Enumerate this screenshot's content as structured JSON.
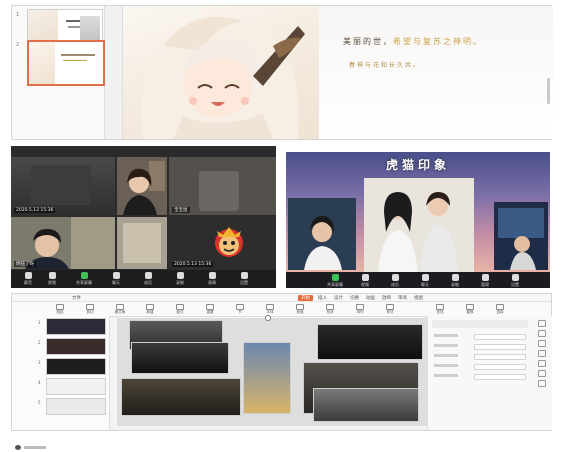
{
  "slide_editor": {
    "slides": [
      {
        "number": "1",
        "selected": false
      },
      {
        "number": "2",
        "selected": true
      }
    ],
    "quote_part1": "美丽的世，",
    "quote_part2": "希望与复苏之神明。",
    "subtitle": "春神与花和长久共。"
  },
  "meeting": {
    "participants": [
      {
        "name": "2020.5.13 15:36"
      },
      {
        "name": ""
      },
      {
        "name": "宝宝鼠"
      },
      {
        "name": "明钰了呀"
      },
      {
        "name": "2020.5.13 15:36"
      }
    ],
    "toolbar": [
      "静音",
      "视频",
      "共享屏幕",
      "聊天",
      "成员",
      "录制",
      "表情",
      "设置"
    ]
  },
  "poster_slide": {
    "title": "虎猫印象",
    "toolbar": [
      "共享屏幕",
      "视频",
      "成员",
      "聊天",
      "录制",
      "管理",
      "设置"
    ]
  },
  "editor": {
    "active_tab": "开始",
    "tabs": [
      "文件",
      "开始",
      "插入",
      "设计",
      "切换",
      "动画",
      "放映",
      "审阅",
      "视图"
    ],
    "ribbon": [
      "粘贴",
      "剪切",
      "格式刷",
      "新建",
      "版式",
      "重置",
      "节",
      "字体",
      "段落",
      "形状",
      "排列",
      "样式",
      "查找",
      "替换",
      "选择"
    ],
    "slide_numbers": [
      "1",
      "2",
      "3",
      "4",
      "5"
    ]
  },
  "colors": {
    "accent": "#e86a3a",
    "selected_border": "#e0704b",
    "quote_gold": "#c9a24a"
  }
}
